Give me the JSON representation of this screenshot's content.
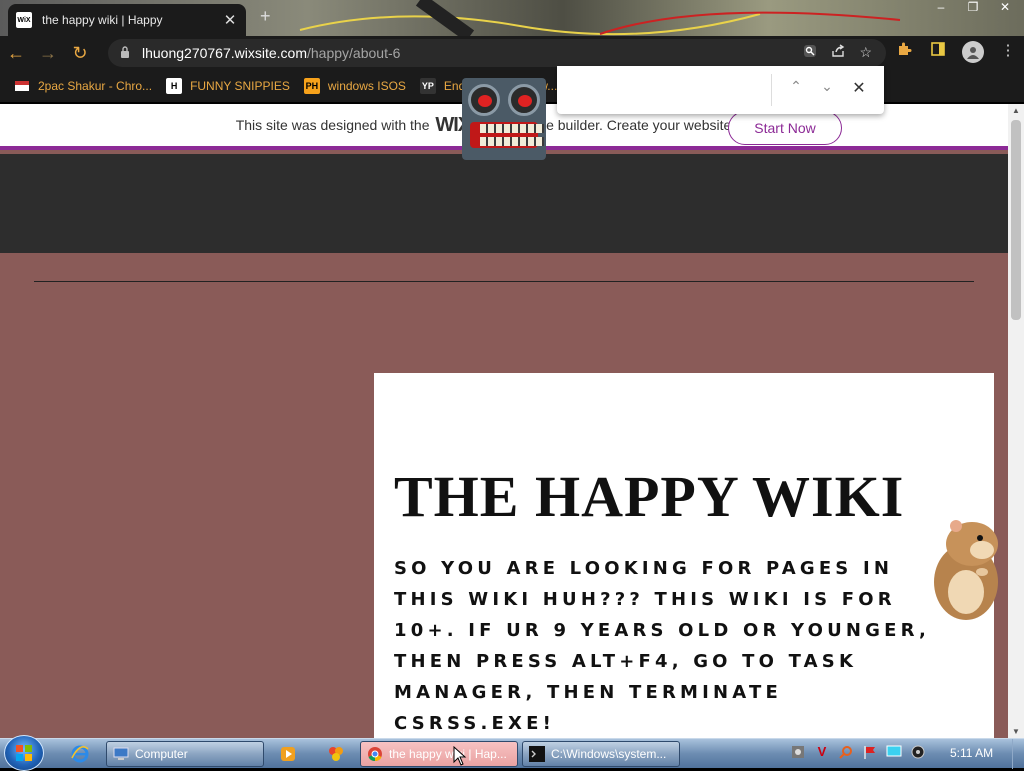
{
  "browser": {
    "tab": {
      "favicon": "WiX",
      "title": "the happy wiki | Happy",
      "close": "✕"
    },
    "new_tab": "+",
    "window_controls": {
      "minimize": "–",
      "restore": "❐",
      "close": "✕"
    },
    "nav": {
      "back": "←",
      "forward": "→",
      "reload": "↻"
    },
    "address": {
      "host": "lhuong270767.wixsite.com",
      "path": "/happy/about-6"
    },
    "bookmarks": [
      {
        "icon": "bookmark-favicon",
        "label": "2pac Shakur - Chro..."
      },
      {
        "icon": "H",
        "label": "FUNNY SNIPPIES"
      },
      {
        "icon": "PH",
        "label": "windows ISOS"
      },
      {
        "icon": "YP",
        "label": "EndermanCH/Malw..."
      }
    ],
    "find": {
      "value": "",
      "prev": "⌃",
      "next": "⌄",
      "close": "✕"
    }
  },
  "page": {
    "banner": {
      "before": "This site was designed with the",
      "wix": "WIX",
      "after": ".com website builder. Create your website today.",
      "cta": "Start Now"
    },
    "card": {
      "title": "THE HAPPY WIKI",
      "body": "So you are looking for pages in this wiki huh??? This wiki is for 10+. If ur 9 years old or younger, then press alt+f4, go to task manager, then terminate csrss.exe!"
    }
  },
  "taskbar": {
    "start": "start-orb",
    "pinned": [
      "ie-icon",
      "media-player-icon",
      "app-icon"
    ],
    "items": [
      {
        "label": "Computer",
        "icon": "computer-icon",
        "active": false
      },
      {
        "label": "the happy wiki | Hap...",
        "icon": "chrome-icon",
        "active": true
      },
      {
        "label": "C:\\Windows\\system...",
        "icon": "cmd-icon",
        "active": false
      }
    ],
    "clock": "5:11 AM"
  },
  "colors": {
    "page_bg": "#8a5b58",
    "header_bg": "#2d2d2d",
    "wix_accent": "#8c2a96",
    "chrome_accent": "#e9a843"
  }
}
